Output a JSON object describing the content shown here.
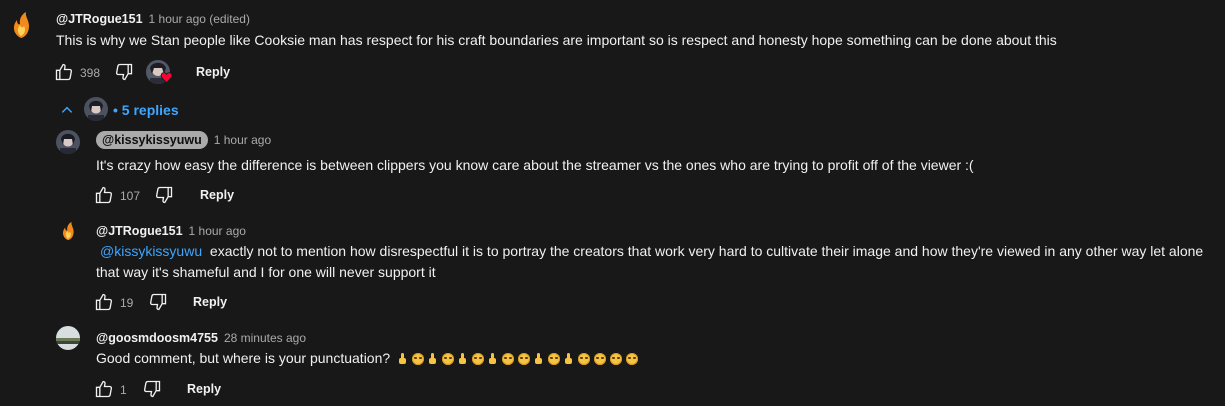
{
  "comments": [
    {
      "author": "@JTRogue151",
      "time": "1 hour ago (edited)",
      "text": "This is why we Stan people like Cooksie man has respect for his craft boundaries are important so is respect and honesty hope something can be done about this",
      "likes": "398",
      "reply_label": "Reply",
      "replies_toggle": "5 replies"
    }
  ],
  "replies": [
    {
      "author": "@kissykissyuwu",
      "time": "1 hour ago",
      "text": "It's crazy how easy the difference is between clippers you know care about the streamer vs the ones who are trying to profit off of the viewer :(",
      "likes": "107",
      "reply_label": "Reply"
    },
    {
      "author": "@JTRogue151",
      "time": "1 hour ago",
      "mention": "@kissykissyuwu",
      "text_line1": "exactly not to mention how disrespectful it is to portray the creators that work very hard to cultivate their image and how they're viewed in any other way let alone",
      "text_line2": "that way it's shameful and I for one will never support it",
      "likes": "19",
      "reply_label": "Reply"
    },
    {
      "author": "@goosmdoosm4755",
      "time": "28 minutes ago",
      "text": "Good comment, but where is your punctuation?",
      "emoji_sequence": [
        "finger",
        "face",
        "finger",
        "face",
        "finger",
        "face",
        "finger",
        "face",
        "face",
        "finger",
        "face",
        "finger",
        "face",
        "face",
        "face",
        "face"
      ],
      "likes": "1",
      "reply_label": "Reply"
    }
  ],
  "colors": {
    "background": "#181818",
    "link": "#3ea6ff",
    "secondary_text": "#aaaaaa",
    "heart": "#ff0033"
  }
}
